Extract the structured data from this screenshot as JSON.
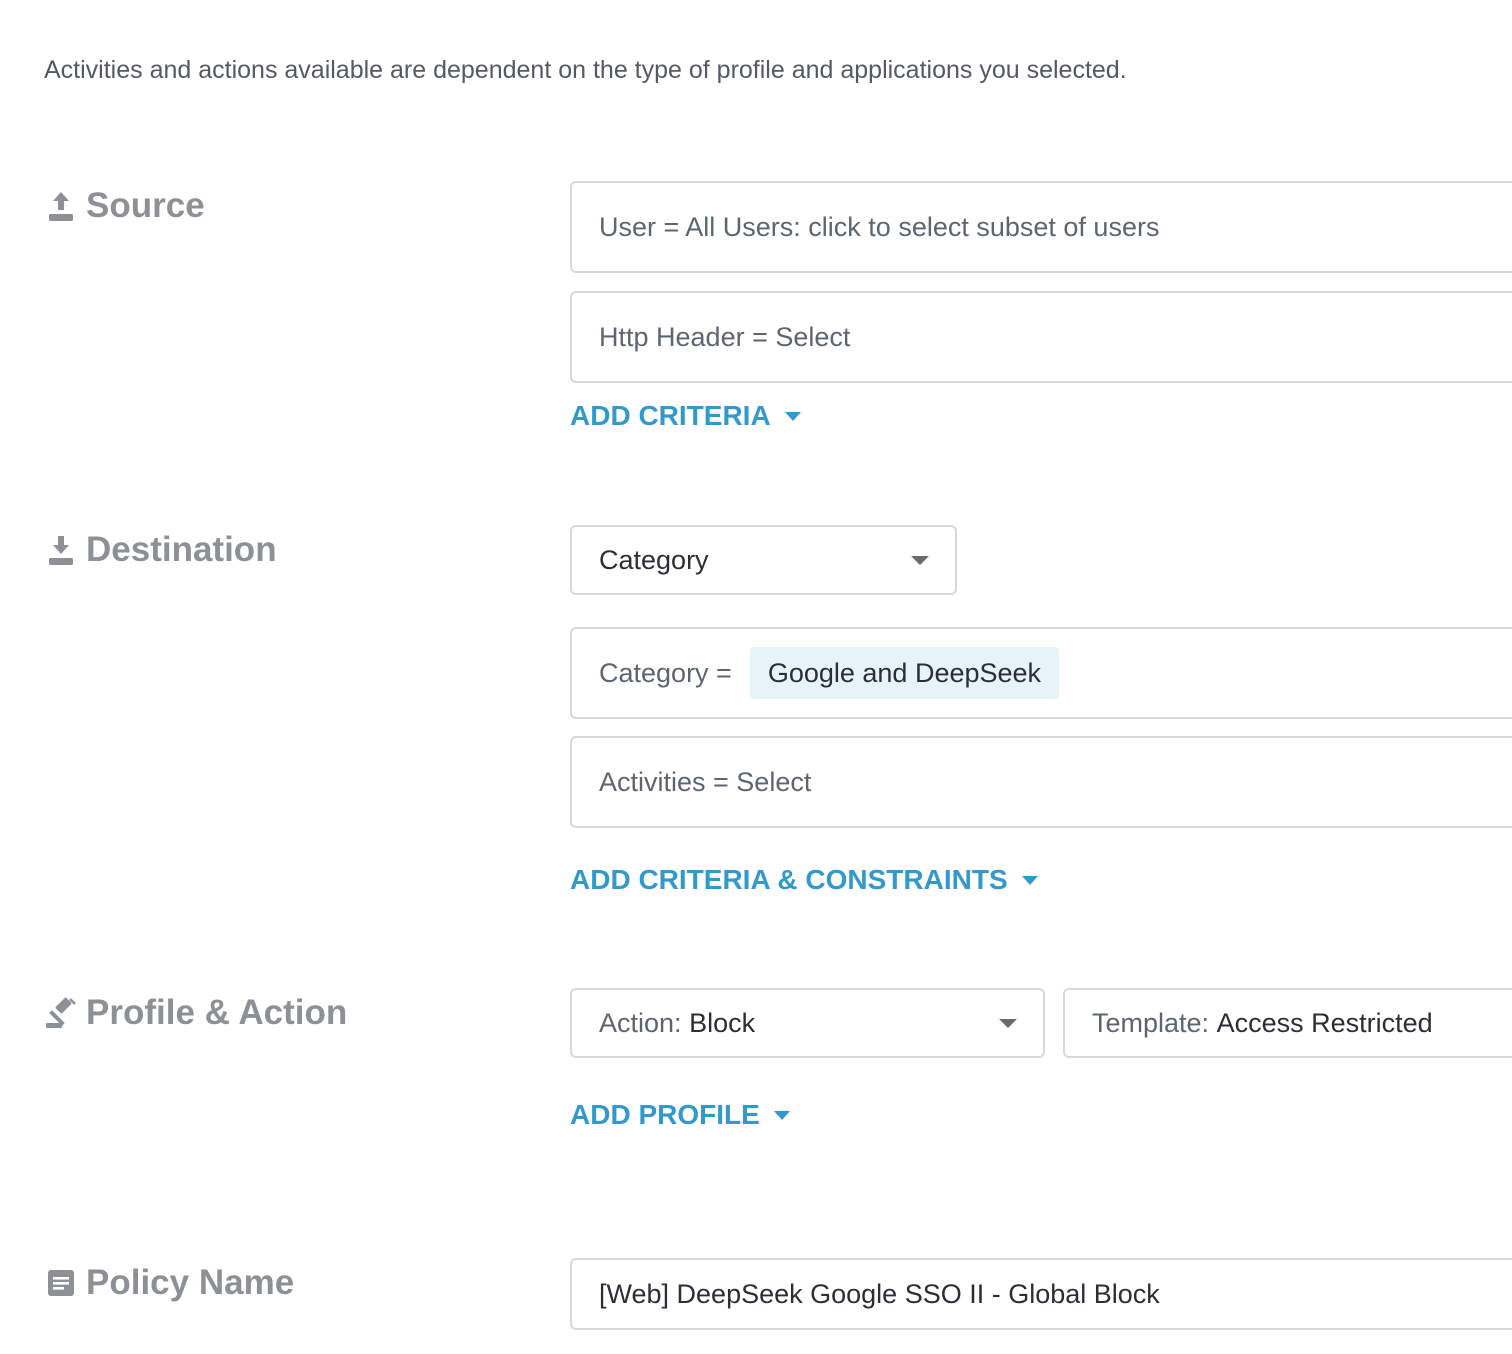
{
  "intro_text": "Activities and actions available are dependent on the type of profile and applications you selected.",
  "source": {
    "label": "Source",
    "icon": "upload-icon",
    "user_field": "User = All Users: click to select subset of users",
    "http_header_field": "Http Header = Select",
    "add_label": "ADD CRITERIA"
  },
  "destination": {
    "label": "Destination",
    "icon": "download-icon",
    "type_select": "Category",
    "category_prefix": "Category =",
    "category_chip": "Google and DeepSeek",
    "activities_field": "Activities = Select",
    "add_label": "ADD CRITERIA & CONSTRAINTS"
  },
  "profile_action": {
    "label": "Profile & Action",
    "icon": "gavel-icon",
    "action_prefix": "Action:",
    "action_value": "Block",
    "template_prefix": "Template:",
    "template_value": "Access Restricted",
    "add_label": "ADD PROFILE"
  },
  "policy_name": {
    "label": "Policy Name",
    "icon": "document-icon",
    "value": "[Web] DeepSeek Google SSO II - Global Block"
  },
  "colors": {
    "accent": "#3399cc",
    "label_gray": "#8d9095",
    "chip_bg": "#e6f4f9",
    "border": "#d6d9dc"
  }
}
